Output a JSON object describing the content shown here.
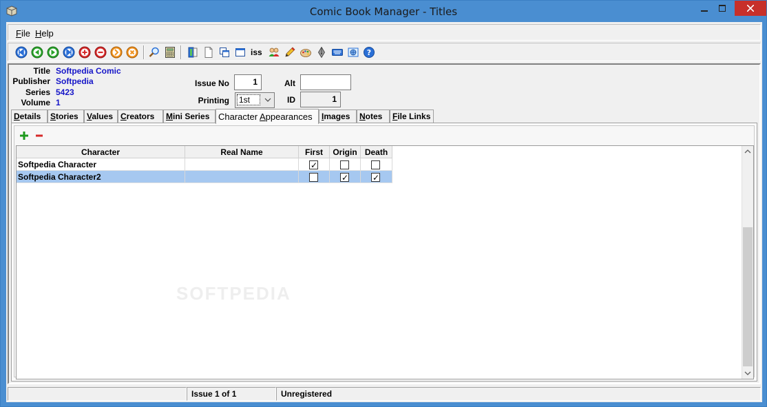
{
  "window": {
    "title": "Comic Book Manager - Titles"
  },
  "menu": [
    {
      "underline": "F",
      "rest": "ile"
    },
    {
      "underline": "H",
      "rest": "elp"
    }
  ],
  "toolbar": {
    "iss_label": "iss",
    "icons": [
      "first-record-icon",
      "previous-record-icon",
      "next-record-icon",
      "last-record-icon",
      "add-record-icon",
      "delete-record-icon",
      "edit-record-icon",
      "cancel-record-icon",
      "search-icon",
      "calculator-icon",
      "book-icon",
      "page-icon",
      "copy-icon",
      "window-icon",
      "issue-icon",
      "people-icon",
      "pencil-icon",
      "palette-icon",
      "pen-nib-icon",
      "keyboard-icon",
      "web-icon",
      "help-icon"
    ]
  },
  "record": {
    "title_label": "Title",
    "title_value": "Softpedia Comic",
    "publisher_label": "Publisher",
    "publisher_value": "Softpedia",
    "series_label": "Series",
    "series_value": "5423",
    "volume_label": "Volume",
    "volume_value": "1",
    "issue_no_label": "Issue No",
    "issue_no_value": "1",
    "alt_label": "Alt",
    "alt_value": "",
    "printing_label": "Printing",
    "printing_value": "1st",
    "id_label": "ID",
    "id_value": "1"
  },
  "tabs": [
    {
      "pre": "",
      "u": "D",
      "post": "etails"
    },
    {
      "pre": "",
      "u": "S",
      "post": "tories"
    },
    {
      "pre": "",
      "u": "V",
      "post": "alues"
    },
    {
      "pre": "",
      "u": "C",
      "post": "reators"
    },
    {
      "pre": "",
      "u": "M",
      "post": "ini Series"
    },
    {
      "pre": "Character ",
      "u": "A",
      "post": "ppearances"
    },
    {
      "pre": "",
      "u": "I",
      "post": "mages"
    },
    {
      "pre": "",
      "u": "N",
      "post": "otes"
    },
    {
      "pre": "",
      "u": "F",
      "post": "ile Links"
    }
  ],
  "grid": {
    "columns": [
      "Character",
      "Real Name",
      "First",
      "Origin",
      "Death"
    ],
    "rows": [
      {
        "character": "Softpedia Character",
        "real_name": "",
        "first": true,
        "origin": false,
        "death": false,
        "selected": false
      },
      {
        "character": "Softpedia Character2",
        "real_name": "",
        "first": false,
        "origin": true,
        "death": true,
        "selected": true
      }
    ]
  },
  "watermark": "SOFTPEDIA",
  "status": {
    "left": "",
    "issue": "Issue 1 of 1",
    "registration": "Unregistered"
  },
  "colors": {
    "titlebar": "#4a8ed1",
    "close": "#c7302a",
    "value_text": "#1515c8",
    "selected_row": "#a6c8f0"
  }
}
